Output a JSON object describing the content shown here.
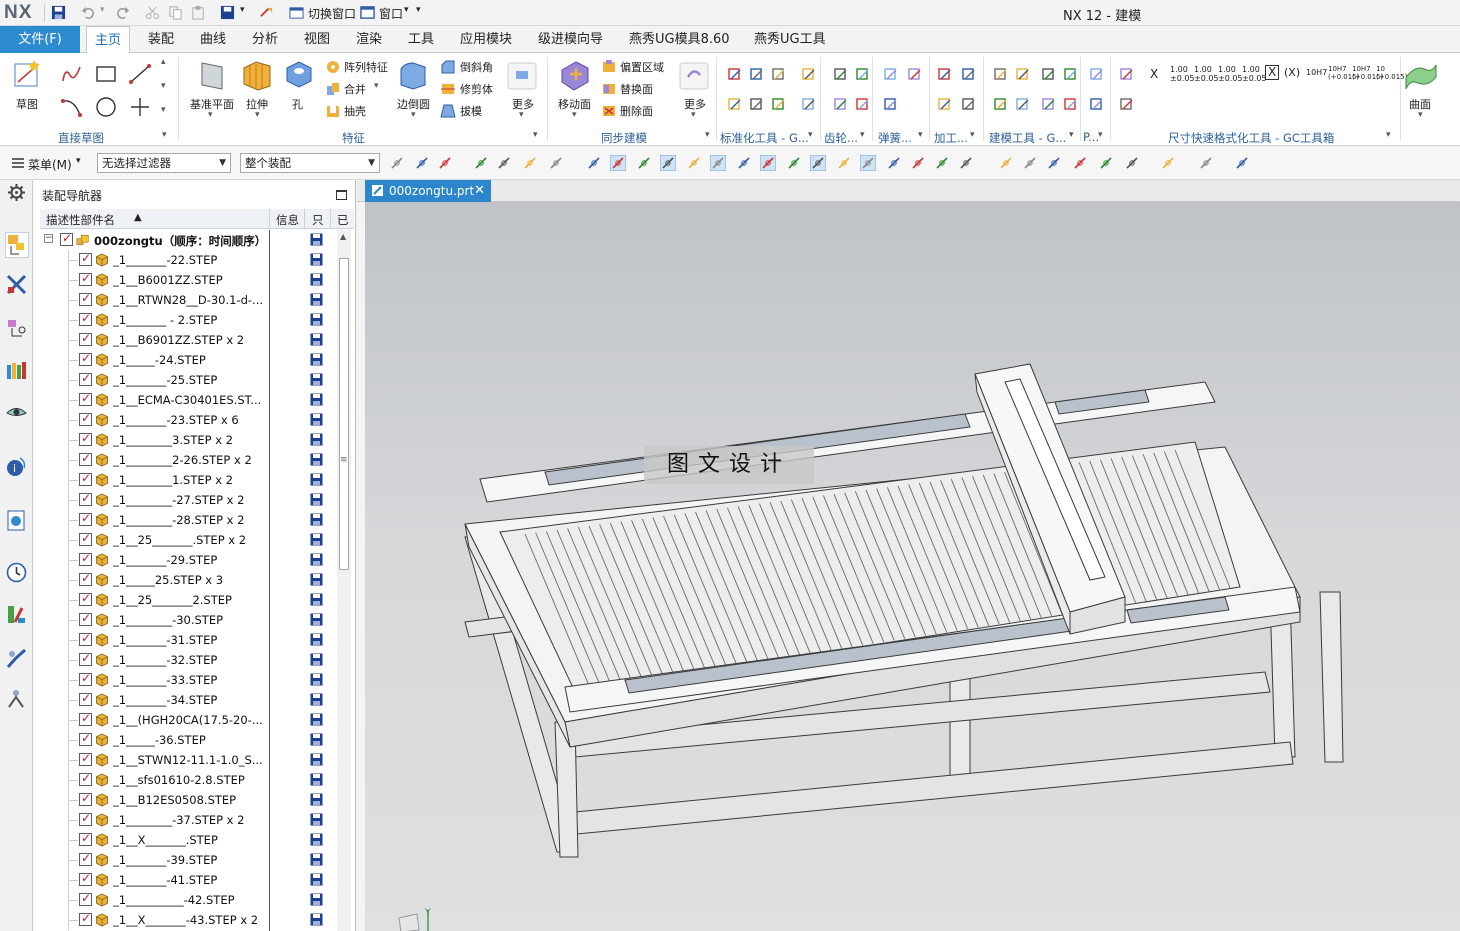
{
  "window": {
    "logo": "NX",
    "title": "NX 12 - 建模"
  },
  "quick_access": {
    "switch_window": "切换窗口",
    "window_menu": "窗口"
  },
  "ribbon_tabs": [
    "文件(F)",
    "主页",
    "装配",
    "曲线",
    "分析",
    "视图",
    "渲染",
    "工具",
    "应用模块",
    "级进模向导",
    "燕秀UG模具8.60",
    "燕秀UG工具"
  ],
  "active_tab": "主页",
  "ribbon": {
    "groups": {
      "direct_sketch": "直接草图",
      "feature": "特征",
      "sync_modeling": "同步建模",
      "standard_tools": "标准化工具 - G...",
      "gear": "齿轮...",
      "spring": "弹簧...",
      "machining": "加工...",
      "modeling_tools": "建模工具 - G...",
      "misc": "P...",
      "dim_format": "尺寸快速格式化工具 - GC工具箱"
    },
    "buttons": {
      "sketch": "草图",
      "datum_plane": "基准平面",
      "extrude": "拉伸",
      "hole": "孔",
      "pattern_feature": "阵列特征",
      "unite": "合并",
      "shell": "抽壳",
      "edge_blend": "边倒圆",
      "chamfer": "倒斜角",
      "trim_body": "修剪体",
      "draft": "拔模",
      "more_feature": "更多",
      "move_face": "移动面",
      "offset_region": "偏置区域",
      "replace_face": "替换面",
      "delete_face": "删除面",
      "more_sync": "更多",
      "surface": "曲面"
    },
    "tolerance_labels": [
      "X",
      "1.00 ±0.05",
      "1.00 ±0.05",
      "1.00 ±0.05",
      "1.00 ±0.05",
      "X",
      "(X)",
      "10H7",
      "10H7 (+0.015)",
      "10H7 (+0.015)",
      "10 (+0.015)"
    ]
  },
  "selection_bar": {
    "menu": "菜单(M)",
    "filter": "无选择过滤器",
    "scope": "整个装配"
  },
  "navigator": {
    "title": "装配导航器",
    "columns": {
      "name": "描述性部件名",
      "info": "信息",
      "readonly": "只",
      "modified": "已"
    },
    "root": "000zongtu（顺序：时间顺序）",
    "parts": [
      "_1_______-22.STEP",
      "_1__B6001ZZ.STEP",
      "_1__RTWN28__D-30.1-d-...",
      "_1_______ - 2.STEP",
      "_1__B6901ZZ.STEP x 2",
      "_1_____-24.STEP",
      "_1_______-25.STEP",
      "_1__ECMA-C30401ES.ST...",
      "_1_______-23.STEP x 6",
      "_1________3.STEP x 2",
      "_1________2-26.STEP x 2",
      "_1________1.STEP x 2",
      "_1________-27.STEP x 2",
      "_1________-28.STEP x 2",
      "_1__25_______.STEP x 2",
      "_1_______-29.STEP",
      "_1_____25.STEP x 3",
      "_1__25_______2.STEP",
      "_1________-30.STEP",
      "_1_______-31.STEP",
      "_1_______-32.STEP",
      "_1_______-33.STEP",
      "_1_______-34.STEP",
      "_1__(HGH20CA(17.5-20-...",
      "_1_____-36.STEP",
      "_1__STWN12-11.1-1.0_S...",
      "_1__sfs01610-2.8.STEP",
      "_1__B12ES0508.STEP",
      "_1________-37.STEP x 2",
      "_1__X_______.STEP",
      "_1_______-39.STEP",
      "_1_______-41.STEP",
      "_1__________-42.STEP",
      "_1__X_______-43.STEP x 2"
    ]
  },
  "document_tab": "000zongtu.prt",
  "viewport": {
    "watermark": "图文设计",
    "triad_label": "Y"
  },
  "colors": {
    "accent": "#2d8ccf",
    "group_label": "#2a5f97",
    "check": "#d0141e",
    "save": "#1d3f8f",
    "part": "#e7b13c"
  }
}
